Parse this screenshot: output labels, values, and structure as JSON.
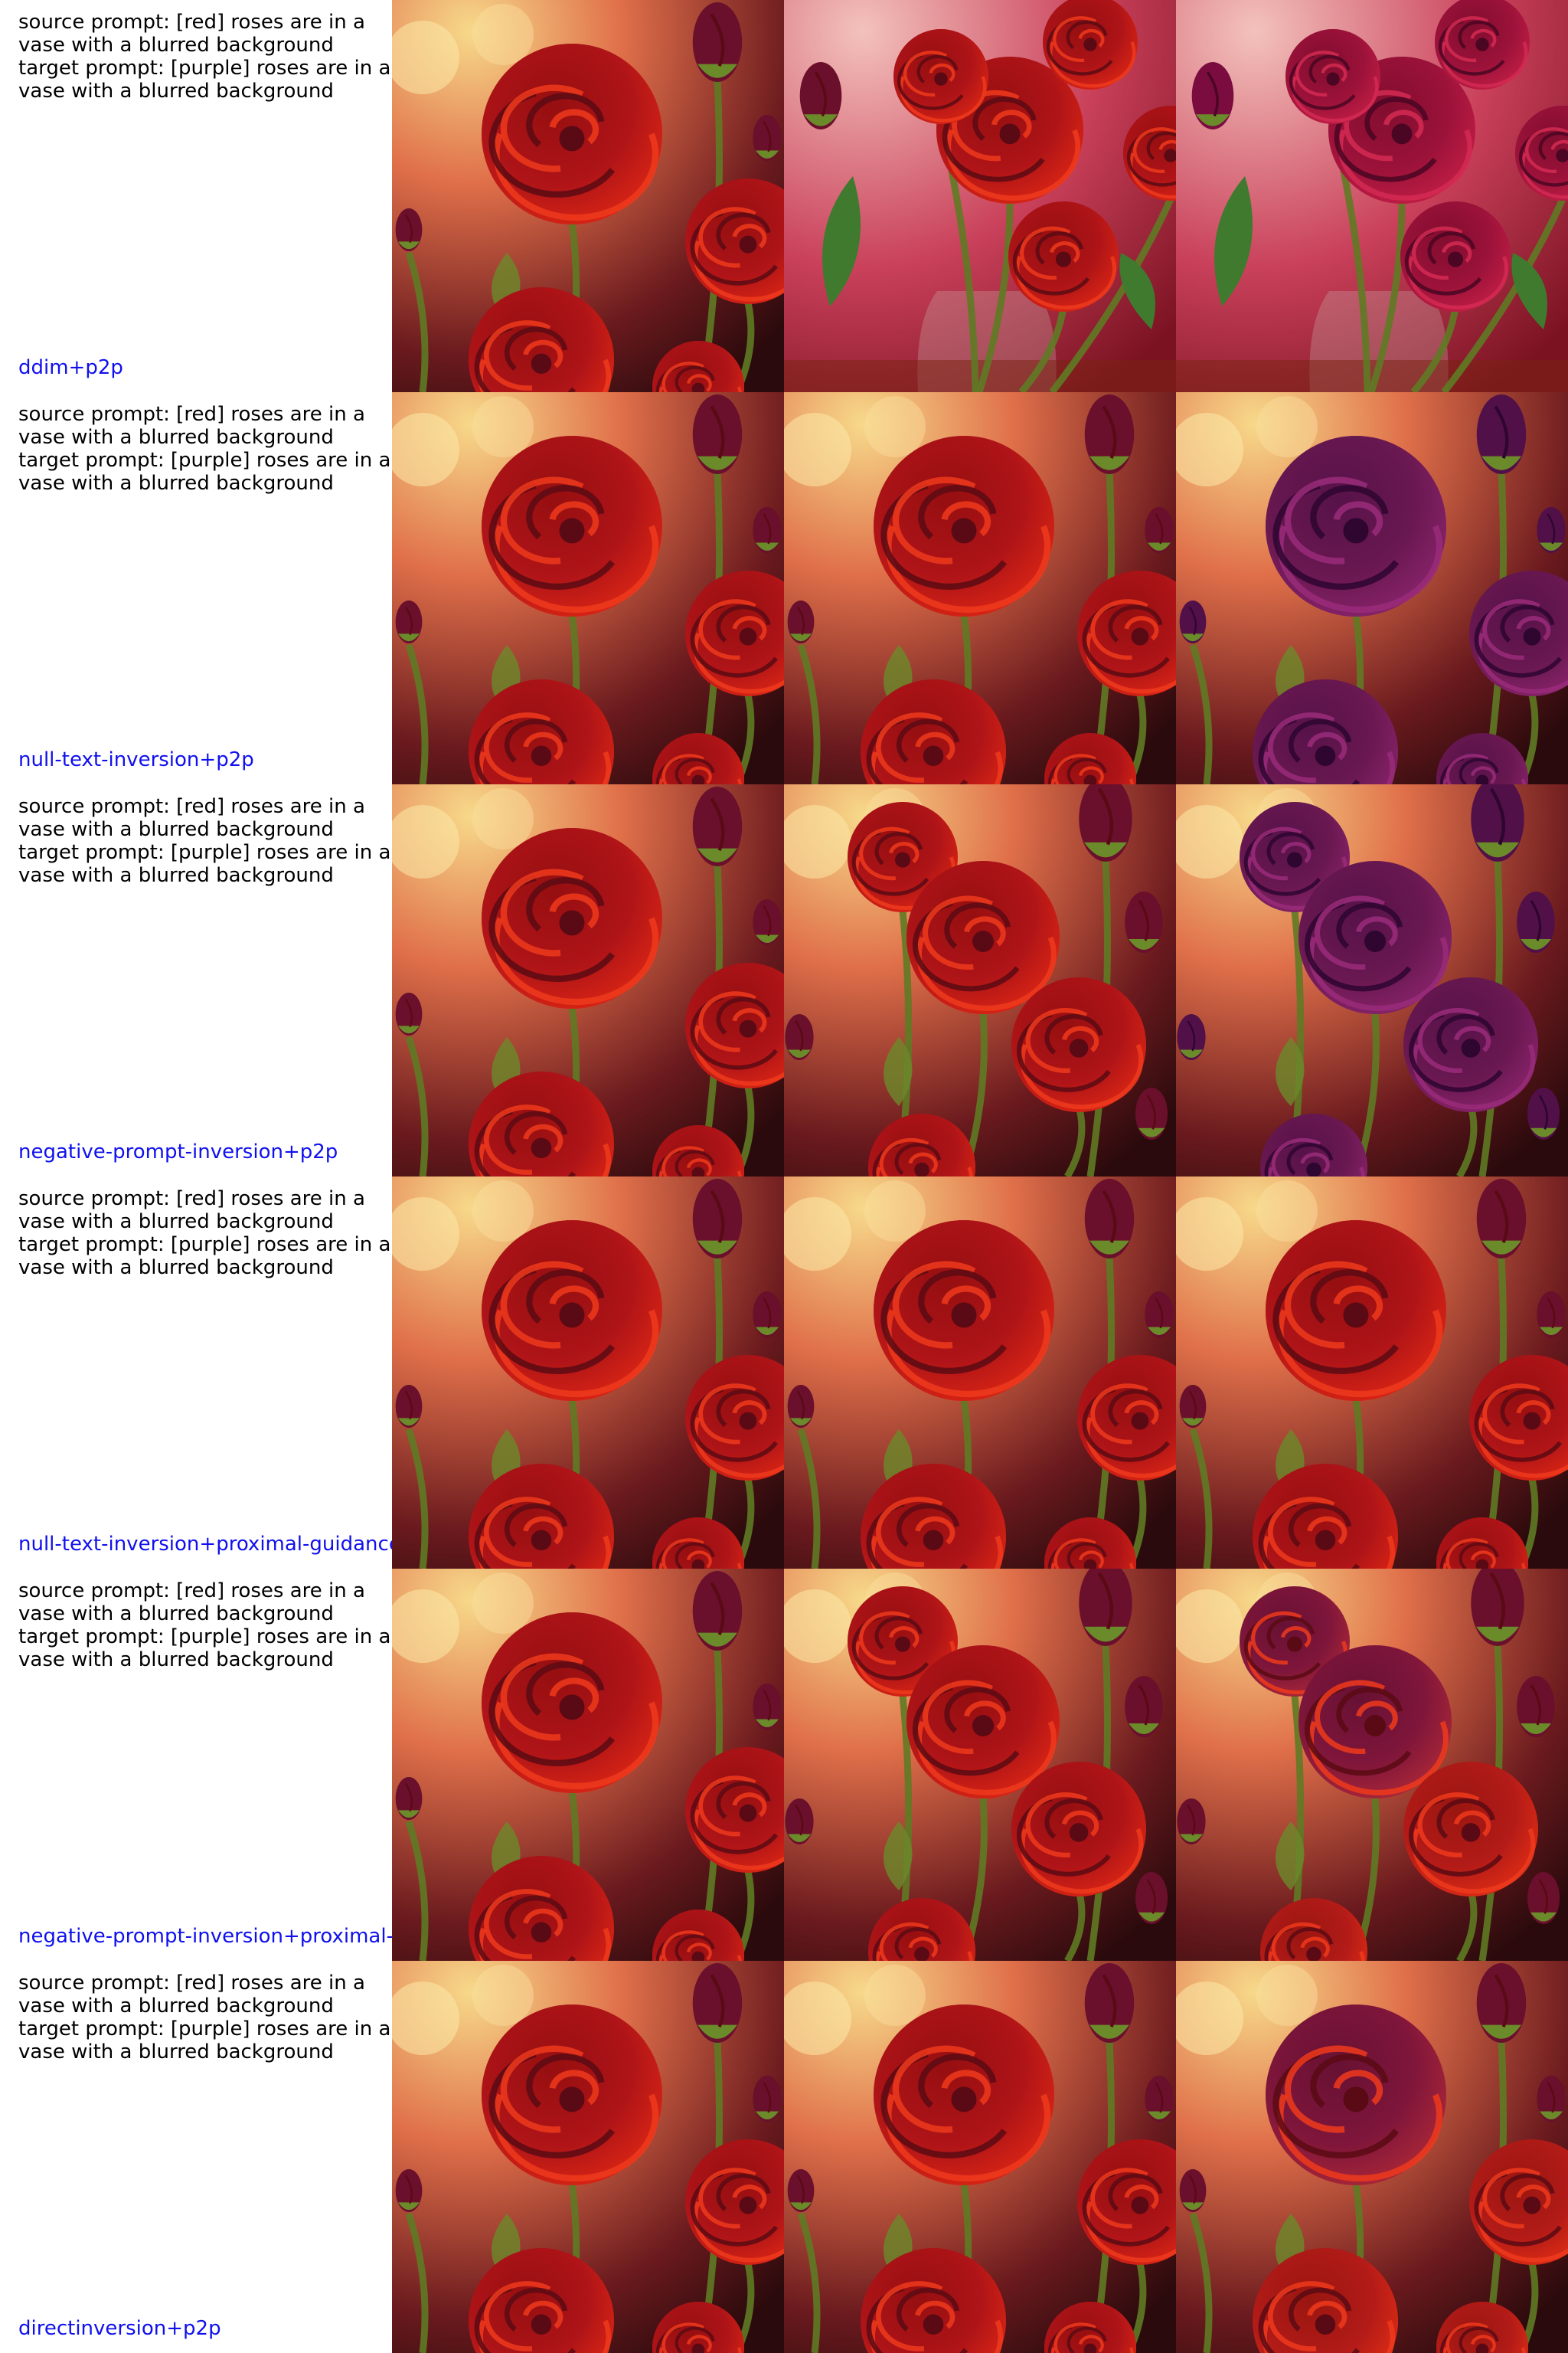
{
  "prompt_lines": [
    "source prompt: [red] roses are in a",
    "vase with a blurred background",
    "target prompt: [purple] roses are in a",
    "vase with a blurred background"
  ],
  "rows": [
    {
      "method": "ddim+p2p",
      "images": [
        {
          "variant": "source",
          "palette": "red"
        },
        {
          "variant": "vase",
          "palette": "red"
        },
        {
          "variant": "vase",
          "palette": "magenta"
        }
      ]
    },
    {
      "method": "null-text-inversion+p2p",
      "images": [
        {
          "variant": "source",
          "palette": "red"
        },
        {
          "variant": "source",
          "palette": "red"
        },
        {
          "variant": "source",
          "palette": "purple"
        }
      ]
    },
    {
      "method": "negative-prompt-inversion+p2p",
      "images": [
        {
          "variant": "source",
          "palette": "red"
        },
        {
          "variant": "cluster",
          "palette": "red"
        },
        {
          "variant": "cluster",
          "palette": "purple"
        }
      ]
    },
    {
      "method": "null-text-inversion+proximal-guidance",
      "images": [
        {
          "variant": "source",
          "palette": "red"
        },
        {
          "variant": "source",
          "palette": "red"
        },
        {
          "variant": "source",
          "palette": "red"
        }
      ]
    },
    {
      "method": "negative-prompt-inversion+proximal-guidance",
      "images": [
        {
          "variant": "source",
          "palette": "red"
        },
        {
          "variant": "cluster",
          "palette": "red"
        },
        {
          "variant": "cluster",
          "palette": "mixed"
        }
      ]
    },
    {
      "method": "directinversion+p2p",
      "images": [
        {
          "variant": "source",
          "palette": "red"
        },
        {
          "variant": "source",
          "palette": "red"
        },
        {
          "variant": "source",
          "palette": "mixed"
        }
      ]
    }
  ],
  "colors": {
    "prompt_text": "#000000",
    "method_text": "#1010ee",
    "background": "#ffffff"
  }
}
